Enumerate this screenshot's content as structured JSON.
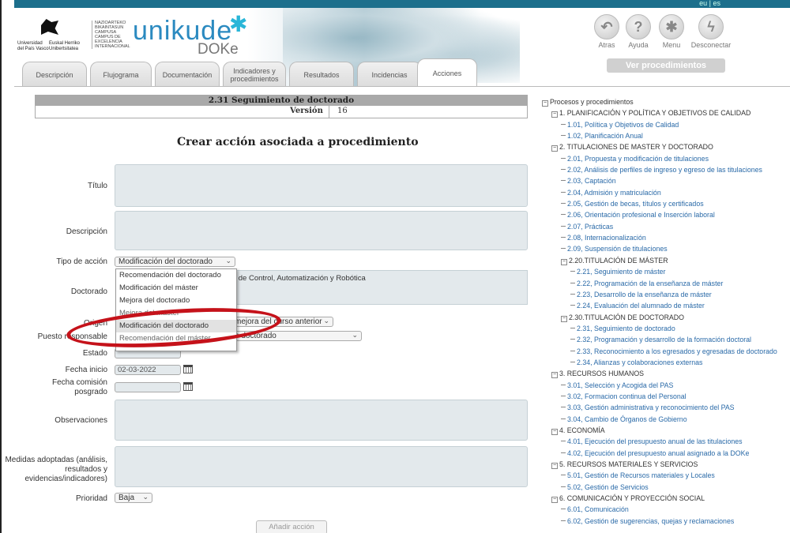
{
  "header": {
    "lang": "eu | es",
    "upv_lines": [
      "Universidad",
      "del País Vasco",
      "Euskal Herriko",
      "Unibertsitatea"
    ],
    "campus_lines": [
      "NAZIOARTEKO",
      "BIKAINTASUN",
      "CAMPUSA",
      "CAMPUS DE",
      "EXCELENCIA",
      "INTERNACIONAL"
    ],
    "brand": "unikude",
    "brand_sub": "DOKe",
    "tools": [
      {
        "label": "Atras",
        "icon": "back-arrow-icon",
        "glyph": "↶"
      },
      {
        "label": "Ayuda",
        "icon": "help-icon",
        "glyph": "?"
      },
      {
        "label": "Menu",
        "icon": "menu-snowflake-icon",
        "glyph": "✱"
      },
      {
        "label": "Desconectar",
        "icon": "disconnect-bolt-icon",
        "glyph": "ϟ"
      }
    ],
    "view_button": "Ver procedimientos"
  },
  "tabs": [
    {
      "label": "Descripción"
    },
    {
      "label": "Flujograma"
    },
    {
      "label": "Documentación"
    },
    {
      "label": "Indicadores y procedimientos"
    },
    {
      "label": "Resultados"
    },
    {
      "label": "Incidencias"
    },
    {
      "label": "Acciones",
      "active": true
    }
  ],
  "procedure": {
    "title": "2.31 Seguimiento de doctorado",
    "version_label": "Versión",
    "version_value": "16"
  },
  "form": {
    "heading": "Crear acción asociada a procedimiento",
    "labels": {
      "titulo": "Título",
      "descripcion": "Descripción",
      "tipo": "Tipo de acción",
      "doctorado": "Doctorado",
      "origen": "Origen",
      "puesto": "Puesto responsable",
      "estado": "Estado",
      "fecha_inicio": "Fecha inicio",
      "fecha_comision": "Fecha comisión posgrado",
      "observaciones": "Observaciones",
      "medidas": "Medidas adoptadas (análisis, resultados y evidencias/indicadores)",
      "prioridad": "Prioridad"
    },
    "tipo_value": "Modificación del doctorado",
    "doctorado_value": "l de Control, Automatización y Robótica",
    "origen_value": "mejora del curso anterior",
    "puesto_value": "e doctorado",
    "fecha_inicio_value": "02-03-2022",
    "prioridad_value": "Baja",
    "add_button": "Añadir acción",
    "tipo_options": [
      "Recomendación del doctorado",
      "Modificación del máster",
      "Mejora del doctorado",
      "Mejora del máster",
      "Modificación del doctorado",
      "Recomendación del máster"
    ],
    "tipo_highlight_index": 4
  },
  "tree": [
    {
      "level": 0,
      "type": "box",
      "text": "Procesos y procedimientos",
      "link": false
    },
    {
      "level": 1,
      "type": "box",
      "text": "1. PLANIFICACIÓN Y POLÍTICA Y OBJETIVOS DE CALIDAD",
      "link": false
    },
    {
      "level": 2,
      "type": "leaf",
      "text": "1.01, Política y Objetivos de Calidad",
      "link": true
    },
    {
      "level": 2,
      "type": "leaf",
      "text": "1.02, Planificación Anual",
      "link": true
    },
    {
      "level": 1,
      "type": "box",
      "text": "2. TITULACIONES DE MASTER Y DOCTORADO",
      "link": false
    },
    {
      "level": 2,
      "type": "leaf",
      "text": "2.01, Propuesta y modificación de titulaciones",
      "link": true
    },
    {
      "level": 2,
      "type": "leaf",
      "text": "2.02, Análisis de perfiles de ingreso y egreso de las titulaciones",
      "link": true
    },
    {
      "level": 2,
      "type": "leaf",
      "text": "2.03, Captación",
      "link": true
    },
    {
      "level": 2,
      "type": "leaf",
      "text": "2.04, Admisión y matriculación",
      "link": true
    },
    {
      "level": 2,
      "type": "leaf",
      "text": "2.05, Gestión de becas, títulos y certificados",
      "link": true
    },
    {
      "level": 2,
      "type": "leaf",
      "text": "2.06, Orientación profesional e Inserción laboral",
      "link": true
    },
    {
      "level": 2,
      "type": "leaf",
      "text": "2.07, Prácticas",
      "link": true
    },
    {
      "level": 2,
      "type": "leaf",
      "text": "2.08, Internacionalización",
      "link": true
    },
    {
      "level": 2,
      "type": "leaf",
      "text": "2.09, Suspensión de titulaciones",
      "link": true
    },
    {
      "level": 2,
      "type": "box",
      "text": "2.20.TITULACIÓN DE MÁSTER",
      "link": false
    },
    {
      "level": 3,
      "type": "leaf",
      "text": "2.21, Seguimiento de máster",
      "link": true
    },
    {
      "level": 3,
      "type": "leaf",
      "text": "2.22, Programación de la enseñanza de máster",
      "link": true
    },
    {
      "level": 3,
      "type": "leaf",
      "text": "2.23, Desarrollo de la enseñanza de máster",
      "link": true
    },
    {
      "level": 3,
      "type": "leaf",
      "text": "2.24, Evaluación del alumnado de máster",
      "link": true
    },
    {
      "level": 2,
      "type": "box",
      "text": "2.30.TITULACIÓN DE DOCTORADO",
      "link": false
    },
    {
      "level": 3,
      "type": "leaf",
      "text": "2.31, Seguimiento de doctorado",
      "link": true
    },
    {
      "level": 3,
      "type": "leaf",
      "text": "2.32, Programación y desarrollo de la formación doctoral",
      "link": true
    },
    {
      "level": 3,
      "type": "leaf",
      "text": "2.33, Reconocimiento a los egresados y egresadas de doctorado",
      "link": true
    },
    {
      "level": 3,
      "type": "leaf",
      "text": "2.34, Alianzas y colaboraciones externas",
      "link": true
    },
    {
      "level": 1,
      "type": "box",
      "text": "3. RECURSOS HUMANOS",
      "link": false
    },
    {
      "level": 2,
      "type": "leaf",
      "text": "3.01, Selección y Acogida del PAS",
      "link": true
    },
    {
      "level": 2,
      "type": "leaf",
      "text": "3.02, Formacion continua del Personal",
      "link": true
    },
    {
      "level": 2,
      "type": "leaf",
      "text": "3.03, Gestión administrativa y reconocimiento del PAS",
      "link": true
    },
    {
      "level": 2,
      "type": "leaf",
      "text": "3.04, Cambio de Órganos de Gobierno",
      "link": true
    },
    {
      "level": 1,
      "type": "box",
      "text": "4. ECONOMÍA",
      "link": false
    },
    {
      "level": 2,
      "type": "leaf",
      "text": "4.01, Ejecución del presupuesto anual de las titulaciones",
      "link": true
    },
    {
      "level": 2,
      "type": "leaf",
      "text": "4.02, Ejecución del presupuesto anual asignado a la DOKe",
      "link": true
    },
    {
      "level": 1,
      "type": "box",
      "text": "5. RECURSOS MATERIALES Y SERVICIOS",
      "link": false
    },
    {
      "level": 2,
      "type": "leaf",
      "text": "5.01, Gestión de Recursos materiales y Locales",
      "link": true
    },
    {
      "level": 2,
      "type": "leaf",
      "text": "5.02, Gestión de Servicios",
      "link": true
    },
    {
      "level": 1,
      "type": "box",
      "text": "6. COMUNICACIÓN Y PROYECCIÓN SOCIAL",
      "link": false
    },
    {
      "level": 2,
      "type": "leaf",
      "text": "6.01, Comunicación",
      "link": true
    },
    {
      "level": 2,
      "type": "leaf",
      "text": "6.02, Gestión de sugerencias, quejas y reclamaciones",
      "link": true
    }
  ],
  "colors": {
    "accent": "#2b8ac0",
    "link": "#2a6aa8",
    "highlight_ellipse": "#c5121a"
  }
}
